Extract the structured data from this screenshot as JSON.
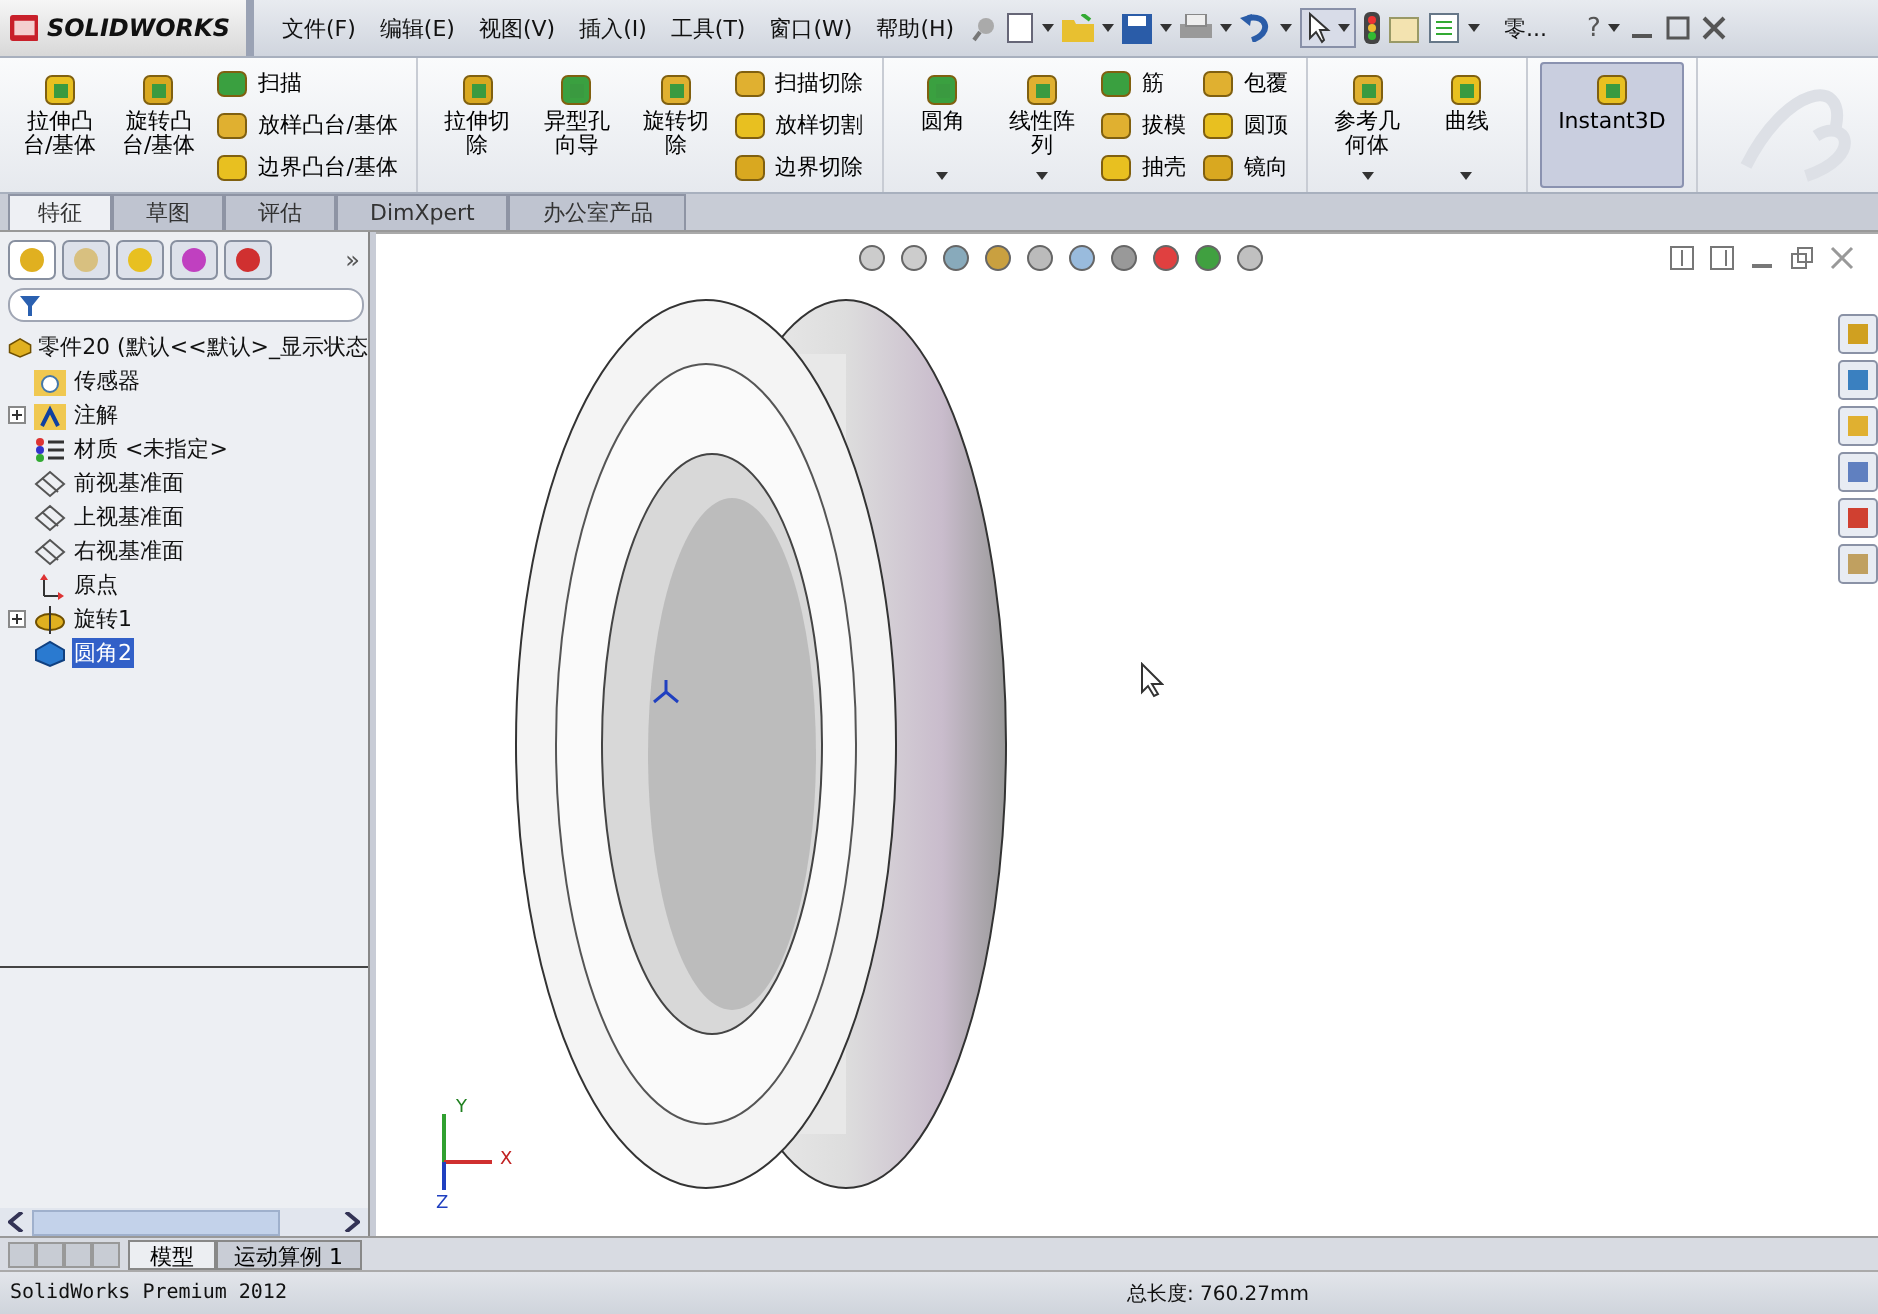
{
  "title_bar": {
    "logo": "SOLIDWORKS",
    "menus": [
      "文件(F)",
      "编辑(E)",
      "视图(V)",
      "插入(I)",
      "工具(T)",
      "窗口(W)",
      "帮助(H)"
    ],
    "document_title": "零...",
    "help": "?"
  },
  "ribbon": {
    "groups": [
      {
        "items": [
          {
            "kind": "large",
            "label": "拉伸凸台/基体",
            "dropdown": false,
            "selected": false
          },
          {
            "kind": "large",
            "label": "旋转凸台/基体",
            "dropdown": false,
            "selected": false
          },
          {
            "kind": "small",
            "labels": [
              "扫描",
              "放样凸台/基体",
              "边界凸台/基体"
            ]
          }
        ]
      },
      {
        "items": [
          {
            "kind": "large",
            "label": "拉伸切除",
            "dropdown": false,
            "selected": false
          },
          {
            "kind": "large",
            "label": "异型孔向导",
            "dropdown": false,
            "selected": false
          },
          {
            "kind": "large",
            "label": "旋转切除",
            "dropdown": false,
            "selected": false
          },
          {
            "kind": "small",
            "labels": [
              "扫描切除",
              "放样切割",
              "边界切除"
            ]
          }
        ]
      },
      {
        "items": [
          {
            "kind": "large",
            "label": "圆角",
            "dropdown": true,
            "selected": false
          },
          {
            "kind": "large",
            "label": "线性阵列",
            "dropdown": true,
            "selected": false
          },
          {
            "kind": "small",
            "labels": [
              "筋",
              "拔模",
              "抽壳"
            ]
          },
          {
            "kind": "small",
            "labels": [
              "包覆",
              "圆顶",
              "镜向"
            ]
          }
        ]
      },
      {
        "items": [
          {
            "kind": "large",
            "label": "参考几何体",
            "dropdown": true,
            "selected": false
          },
          {
            "kind": "large",
            "label": "曲线",
            "dropdown": true,
            "selected": false
          }
        ]
      },
      {
        "items": [
          {
            "kind": "toggle",
            "label": "Instant3D",
            "dropdown": false,
            "selected": true
          }
        ]
      }
    ]
  },
  "command_tabs": [
    {
      "label": "特征",
      "selected": true
    },
    {
      "label": "草图",
      "selected": false
    },
    {
      "label": "评估",
      "selected": false
    },
    {
      "label": "DimXpert",
      "selected": false
    },
    {
      "label": "办公室产品",
      "selected": false
    }
  ],
  "feature_tree": {
    "more": "»",
    "root": "零件20  (默认<<默认>_显示状态",
    "items": [
      {
        "label": "传感器",
        "kind": "sensor",
        "expandable": false,
        "selected": false
      },
      {
        "label": "注解",
        "kind": "annotation",
        "expandable": true,
        "selected": false
      },
      {
        "label": "材质 <未指定>",
        "kind": "material",
        "expandable": false,
        "selected": false
      },
      {
        "label": "前视基准面",
        "kind": "plane",
        "expandable": false,
        "selected": false
      },
      {
        "label": "上视基准面",
        "kind": "plane",
        "expandable": false,
        "selected": false
      },
      {
        "label": "右视基准面",
        "kind": "plane",
        "expandable": false,
        "selected": false
      },
      {
        "label": "原点",
        "kind": "origin",
        "expandable": false,
        "selected": false
      },
      {
        "label": "旋转1",
        "kind": "revolve",
        "expandable": true,
        "selected": false
      },
      {
        "label": "圆角2",
        "kind": "fillet",
        "expandable": false,
        "selected": true
      }
    ]
  },
  "sheet_tabs": [
    {
      "label": "模型",
      "selected": true
    },
    {
      "label": "运动算例 1",
      "selected": false
    }
  ],
  "viewport": {
    "triad": [
      "Y",
      "X",
      "Z"
    ]
  },
  "status_bar": {
    "product": "SolidWorks Premium 2012",
    "measure": "总长度: 760.27mm"
  }
}
